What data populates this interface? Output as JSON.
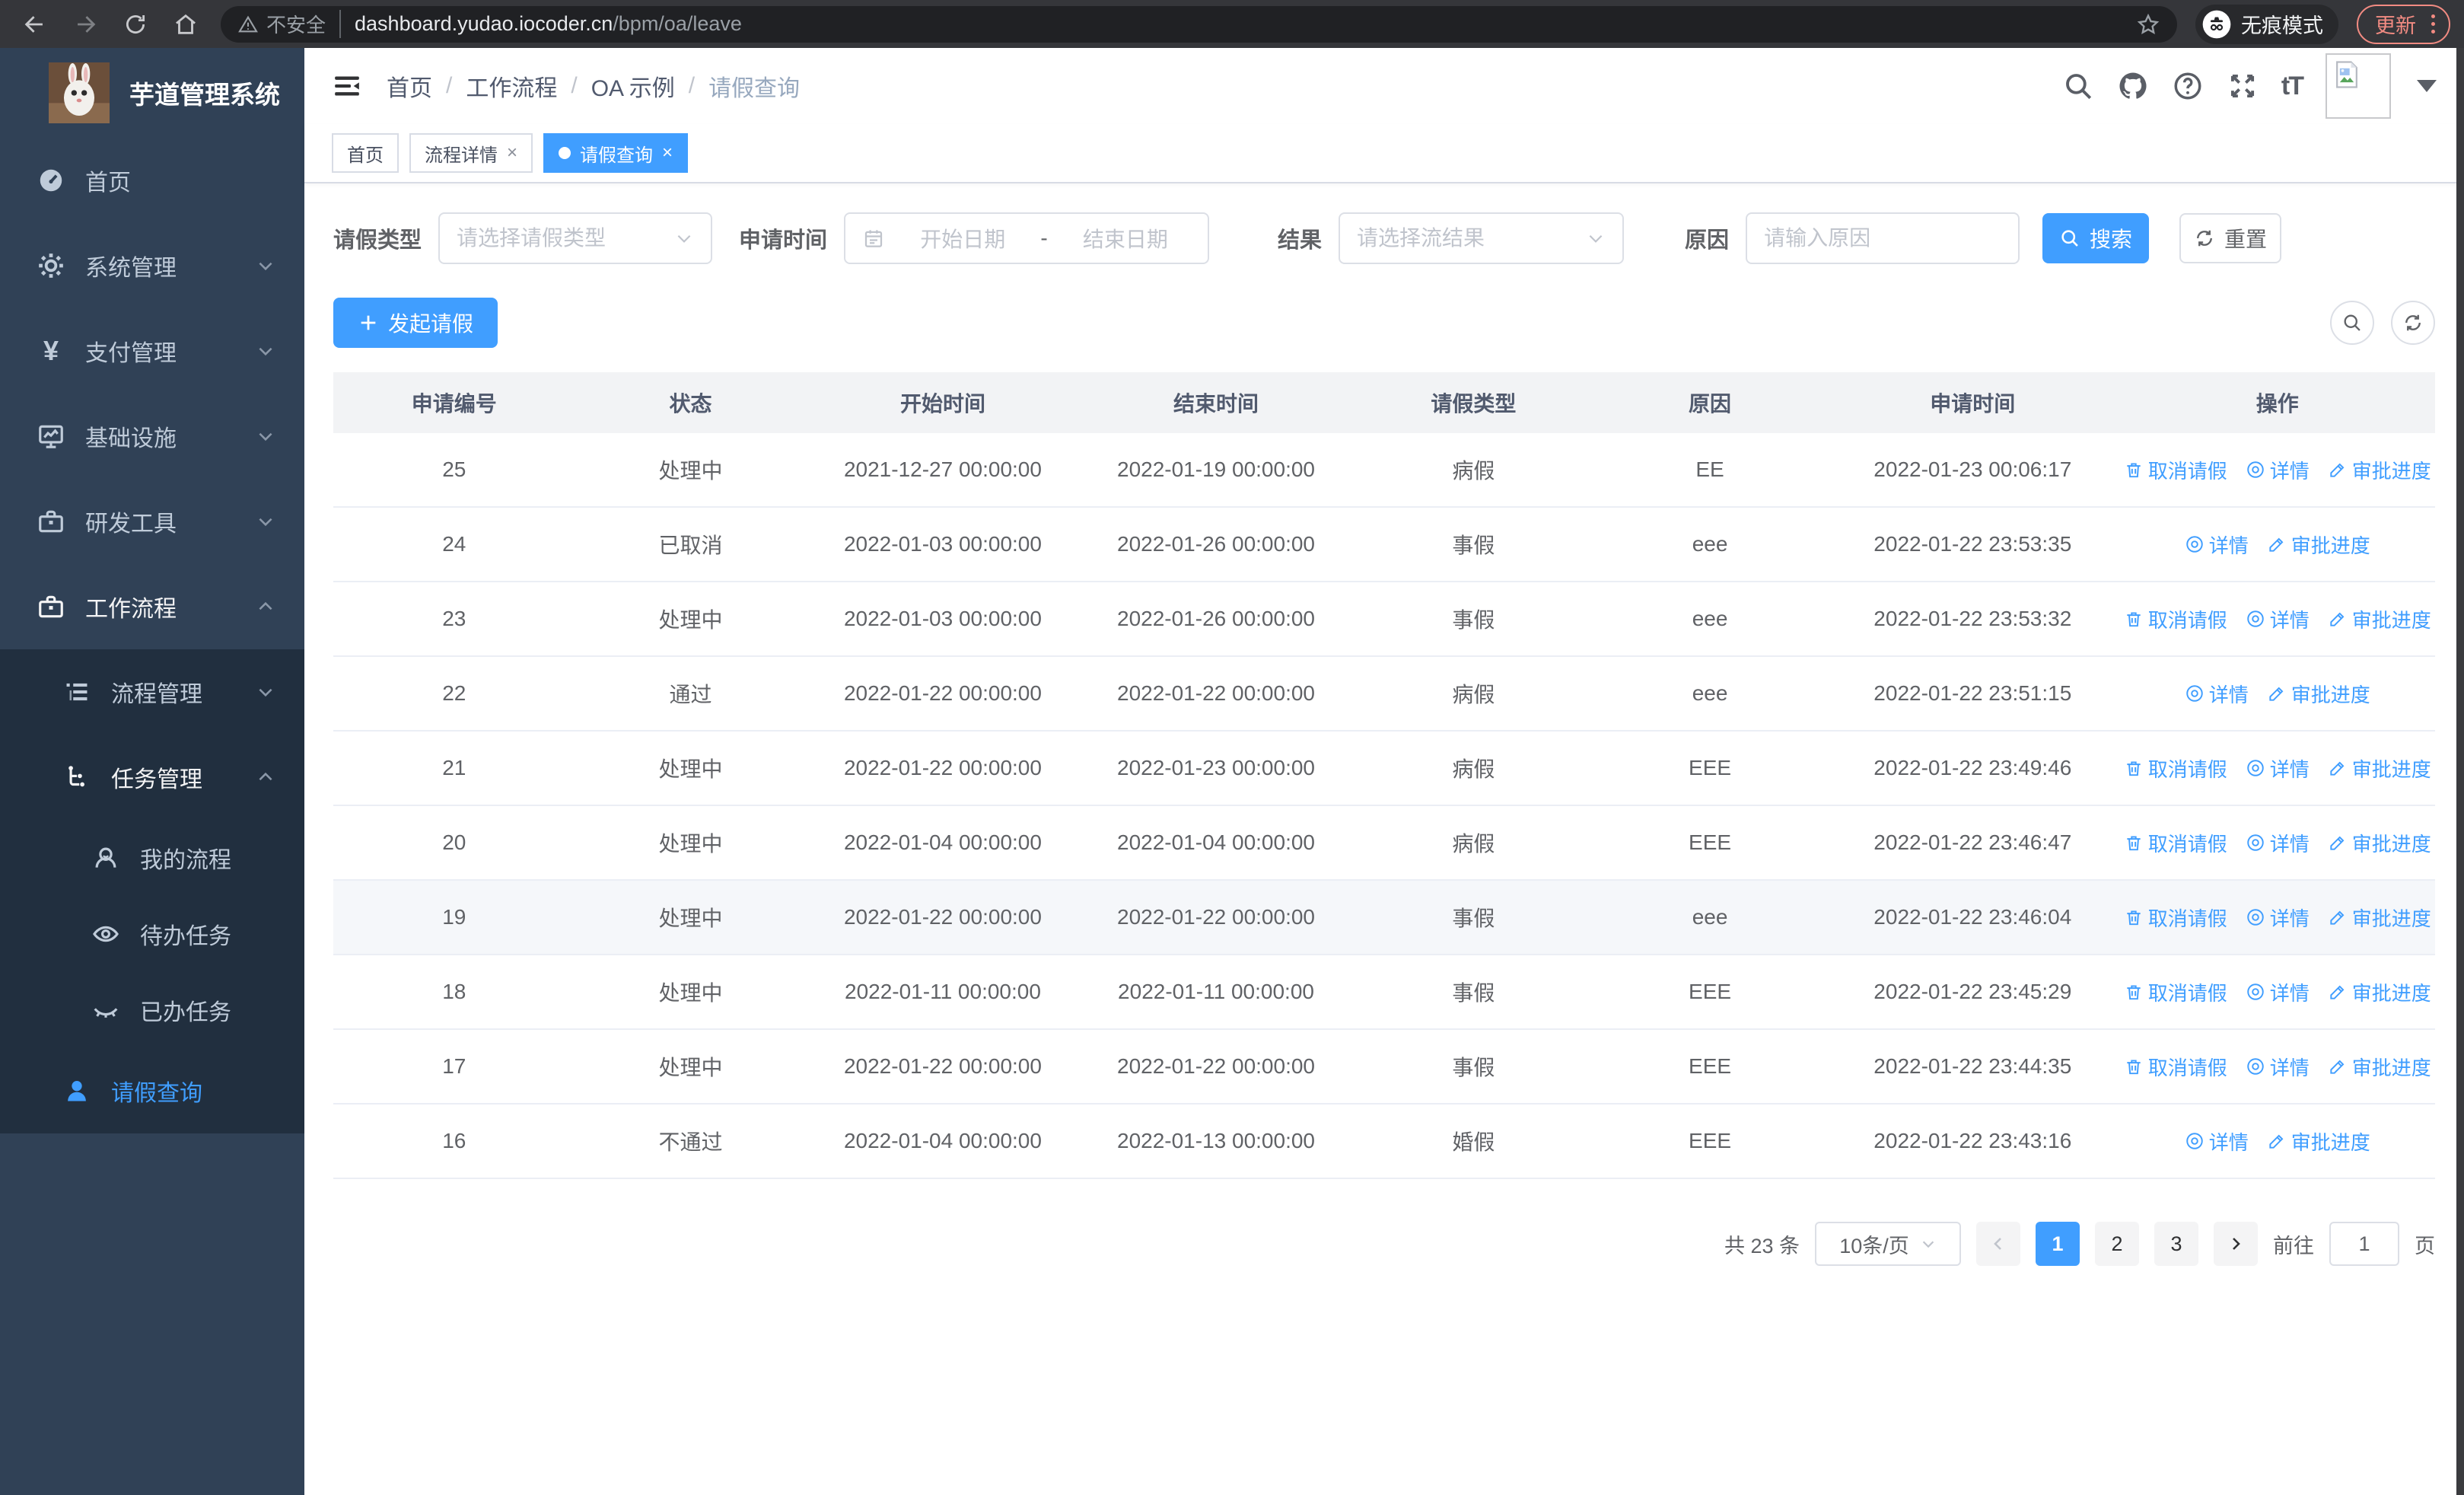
{
  "chrome": {
    "security_text": "不安全",
    "url_host": "dashboard.yudao.iocoder.cn",
    "url_path": "/bpm/oa/leave",
    "incognito_label": "无痕模式",
    "update_label": "更新"
  },
  "sidebar": {
    "title": "芋道管理系统",
    "items": [
      {
        "label": "首页"
      },
      {
        "label": "系统管理"
      },
      {
        "label": "支付管理"
      },
      {
        "label": "基础设施"
      },
      {
        "label": "研发工具"
      },
      {
        "label": "工作流程"
      },
      {
        "label": "流程管理"
      },
      {
        "label": "任务管理"
      },
      {
        "label": "我的流程"
      },
      {
        "label": "待办任务"
      },
      {
        "label": "已办任务"
      },
      {
        "label": "请假查询"
      }
    ]
  },
  "header": {
    "breadcrumb": [
      "首页",
      "工作流程",
      "OA 示例",
      "请假查询"
    ],
    "font_size_icon": "tT"
  },
  "tabs": [
    {
      "label": "首页"
    },
    {
      "label": "流程详情"
    },
    {
      "label": "请假查询"
    }
  ],
  "filters": {
    "leave_type_label": "请假类型",
    "leave_type_placeholder": "请选择请假类型",
    "apply_time_label": "申请时间",
    "date_start_placeholder": "开始日期",
    "date_separator": "-",
    "date_end_placeholder": "结束日期",
    "result_label": "结果",
    "result_placeholder": "请选择流结果",
    "reason_label": "原因",
    "reason_placeholder": "请输入原因",
    "search_label": "搜索",
    "reset_label": "重置"
  },
  "toolbar": {
    "create_label": "发起请假"
  },
  "table": {
    "columns": [
      "申请编号",
      "状态",
      "开始时间",
      "结束时间",
      "请假类型",
      "原因",
      "申请时间",
      "操作"
    ],
    "action_labels": {
      "cancel": "取消请假",
      "detail": "详情",
      "progress": "审批进度"
    },
    "rows": [
      {
        "id": "25",
        "status": "处理中",
        "start": "2021-12-27 00:00:00",
        "end": "2022-01-19 00:00:00",
        "type": "病假",
        "reason": "EE",
        "applied": "2022-01-23 00:06:17",
        "actions": [
          "cancel",
          "detail",
          "progress"
        ],
        "highlight": false
      },
      {
        "id": "24",
        "status": "已取消",
        "start": "2022-01-03 00:00:00",
        "end": "2022-01-26 00:00:00",
        "type": "事假",
        "reason": "eee",
        "applied": "2022-01-22 23:53:35",
        "actions": [
          "detail",
          "progress"
        ],
        "highlight": false
      },
      {
        "id": "23",
        "status": "处理中",
        "start": "2022-01-03 00:00:00",
        "end": "2022-01-26 00:00:00",
        "type": "事假",
        "reason": "eee",
        "applied": "2022-01-22 23:53:32",
        "actions": [
          "cancel",
          "detail",
          "progress"
        ],
        "highlight": false
      },
      {
        "id": "22",
        "status": "通过",
        "start": "2022-01-22 00:00:00",
        "end": "2022-01-22 00:00:00",
        "type": "病假",
        "reason": "eee",
        "applied": "2022-01-22 23:51:15",
        "actions": [
          "detail",
          "progress"
        ],
        "highlight": false
      },
      {
        "id": "21",
        "status": "处理中",
        "start": "2022-01-22 00:00:00",
        "end": "2022-01-23 00:00:00",
        "type": "病假",
        "reason": "EEE",
        "applied": "2022-01-22 23:49:46",
        "actions": [
          "cancel",
          "detail",
          "progress"
        ],
        "highlight": false
      },
      {
        "id": "20",
        "status": "处理中",
        "start": "2022-01-04 00:00:00",
        "end": "2022-01-04 00:00:00",
        "type": "病假",
        "reason": "EEE",
        "applied": "2022-01-22 23:46:47",
        "actions": [
          "cancel",
          "detail",
          "progress"
        ],
        "highlight": false
      },
      {
        "id": "19",
        "status": "处理中",
        "start": "2022-01-22 00:00:00",
        "end": "2022-01-22 00:00:00",
        "type": "事假",
        "reason": "eee",
        "applied": "2022-01-22 23:46:04",
        "actions": [
          "cancel",
          "detail",
          "progress"
        ],
        "highlight": true
      },
      {
        "id": "18",
        "status": "处理中",
        "start": "2022-01-11 00:00:00",
        "end": "2022-01-11 00:00:00",
        "type": "事假",
        "reason": "EEE",
        "applied": "2022-01-22 23:45:29",
        "actions": [
          "cancel",
          "detail",
          "progress"
        ],
        "highlight": false
      },
      {
        "id": "17",
        "status": "处理中",
        "start": "2022-01-22 00:00:00",
        "end": "2022-01-22 00:00:00",
        "type": "事假",
        "reason": "EEE",
        "applied": "2022-01-22 23:44:35",
        "actions": [
          "cancel",
          "detail",
          "progress"
        ],
        "highlight": false
      },
      {
        "id": "16",
        "status": "不通过",
        "start": "2022-01-04 00:00:00",
        "end": "2022-01-13 00:00:00",
        "type": "婚假",
        "reason": "EEE",
        "applied": "2022-01-22 23:43:16",
        "actions": [
          "detail",
          "progress"
        ],
        "highlight": false
      }
    ]
  },
  "pagination": {
    "total": "共 23 条",
    "page_size": "10条/页",
    "pages": [
      "1",
      "2",
      "3"
    ],
    "active_page": "1",
    "goto_label": "前往",
    "goto_value": "1",
    "goto_suffix": "页"
  },
  "colors": {
    "accent": "#409eff",
    "sidebar_bg": "#304156",
    "submenu_bg": "#212f3f",
    "update_accent": "#f28b82"
  }
}
